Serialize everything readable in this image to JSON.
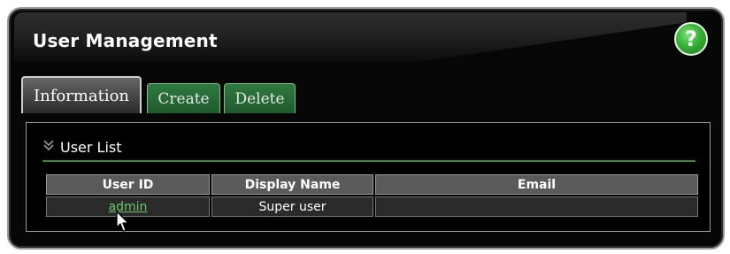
{
  "window": {
    "title": "User Management",
    "help_label": "?"
  },
  "tabs": [
    {
      "label": "Information",
      "active": true
    },
    {
      "label": "Create",
      "active": false
    },
    {
      "label": "Delete",
      "active": false
    }
  ],
  "section": {
    "title": "User List",
    "icon": "double-chevron-down-icon"
  },
  "table": {
    "columns": [
      "User ID",
      "Display Name",
      "Email"
    ],
    "rows": [
      {
        "user_id": "admin",
        "display_name": "Super user",
        "email": ""
      }
    ]
  },
  "colors": {
    "accent_green": "#2e8f2e",
    "link_green": "#6fc66f",
    "help_green": "#36b236"
  }
}
